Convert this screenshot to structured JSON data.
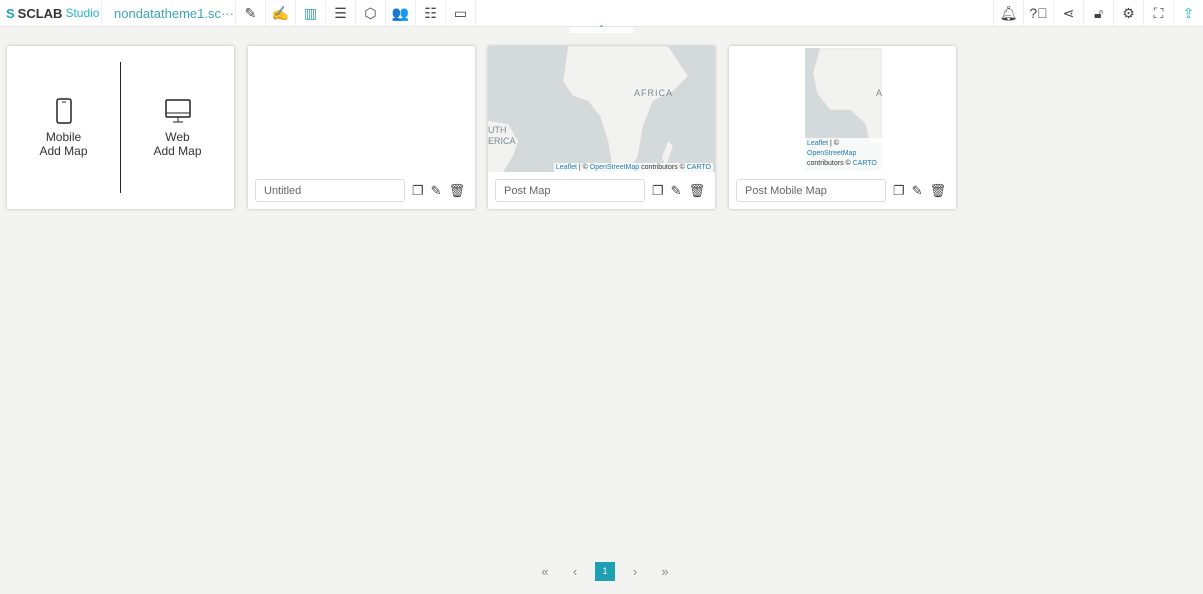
{
  "header": {
    "logo_text": "SCLAB",
    "logo_sub": "Studio",
    "project": "nondatatheme1.sc···",
    "tools": [
      "design-edit-icon",
      "edit-icon",
      "map-icon",
      "database-icon",
      "code-icon",
      "users-icon",
      "list-icon",
      "card-icon"
    ],
    "right_tools": [
      "bell-icon",
      "help-icon",
      "share-icon",
      "unlock-icon",
      "gear-icon",
      "fullscreen-icon",
      "upload-icon"
    ],
    "collapse": "⌃"
  },
  "add_card": {
    "mobile": [
      "Mobile",
      "Add Map"
    ],
    "web": [
      "Web",
      "Add Map"
    ]
  },
  "maps": [
    {
      "name": "Untitled",
      "has_map": false
    },
    {
      "name": "Post Map",
      "has_map": true,
      "labels": [
        "AFRICA",
        "UTH",
        "ERICA"
      ],
      "attribution": {
        "leaflet": "Leaflet",
        "sep": " | © ",
        "osm": "OpenStreetMap",
        "contrib": " contributors © ",
        "carto": "CARTO"
      }
    },
    {
      "name": "Post Mobile Map",
      "has_map": true,
      "labels": [
        "A"
      ],
      "attribution": {
        "leaflet": "Leaflet",
        "sep": " | ©",
        "osm": "OpenStreetMap",
        "contrib": "contributors © ",
        "carto": "CARTO"
      }
    }
  ],
  "pagination": {
    "first": "«",
    "prev": "‹",
    "current": "1",
    "next": "›",
    "last": "»"
  },
  "colors": {
    "accent": "#1fa0b2",
    "ocean": "#d4dadc",
    "land": "#f2f2f0"
  }
}
